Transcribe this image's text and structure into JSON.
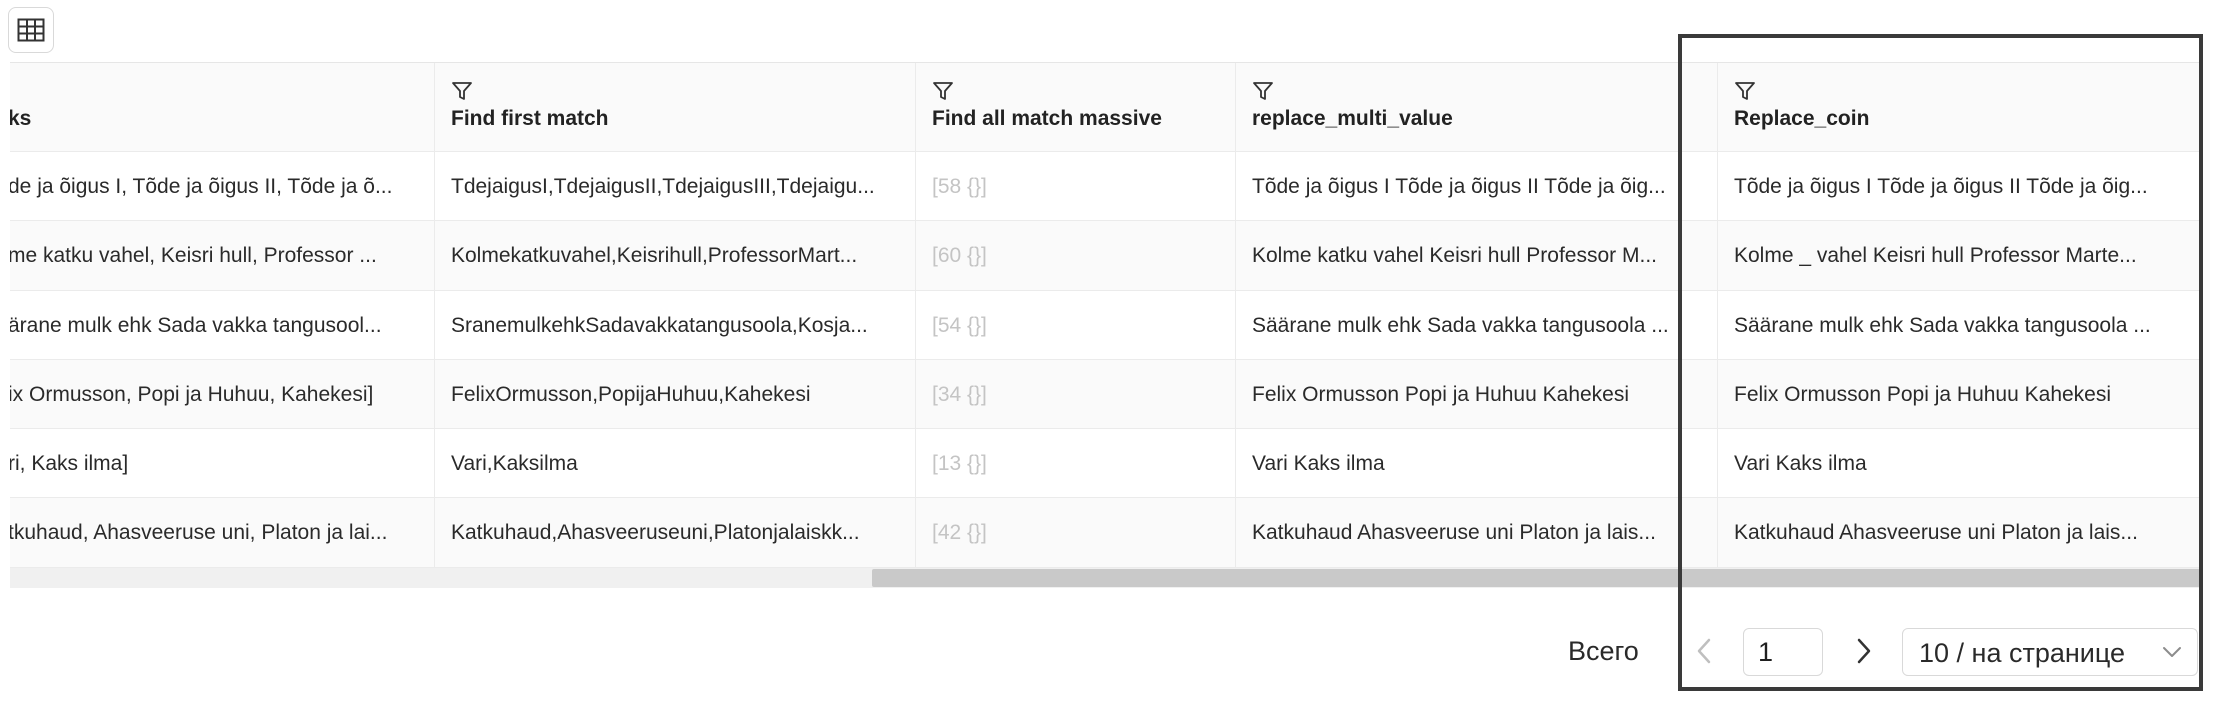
{
  "toolbar": {
    "table_icon": "table-grid-icon"
  },
  "columns": [
    {
      "key": "title",
      "label": "ks",
      "show_filter": false
    },
    {
      "key": "first",
      "label": "Find first match",
      "show_filter": true
    },
    {
      "key": "all",
      "label": "Find all match massive",
      "show_filter": true
    },
    {
      "key": "multi",
      "label": "replace_multi_value",
      "show_filter": true
    },
    {
      "key": "coin",
      "label": "Replace_coin",
      "show_filter": true
    }
  ],
  "rows": [
    {
      "title": "de ja õigus I, Tõde ja õigus II, Tõde ja õ...",
      "first": "TdejaigusI,TdejaigusII,TdejaigusIII,Tdejaigu...",
      "all": "[58 {}]",
      "multi": "Tõde ja õigus I Tõde ja õigus II Tõde ja õig...",
      "coin": "Tõde ja õigus I Tõde ja õigus II Tõde ja õig..."
    },
    {
      "title": "me katku vahel, Keisri hull, Professor ...",
      "first": "Kolmekatkuvahel,Keisrihull,ProfessorMart...",
      "all": "[60 {}]",
      "multi": "Kolme katku vahel Keisri hull Professor M...",
      "coin": "Kolme _ vahel Keisri hull Professor Marte..."
    },
    {
      "title": "ärane mulk ehk Sada vakka tangusool...",
      "first": "SranemulkehkSadavakkatangusoola,Kosja...",
      "all": "[54 {}]",
      "multi": "Säärane mulk ehk Sada vakka tangusoola ...",
      "coin": "Säärane mulk ehk Sada vakka tangusoola ..."
    },
    {
      "title": "ix Ormusson, Popi ja Huhuu, Kahekesi]",
      "first": "FelixOrmusson,PopijaHuhuu,Kahekesi",
      "all": "[34 {}]",
      "multi": "Felix Ormusson Popi ja Huhuu Kahekesi",
      "coin": "Felix Ormusson Popi ja Huhuu Kahekesi"
    },
    {
      "title": "ri, Kaks ilma]",
      "first": "Vari,Kaksilma",
      "all": "[13 {}]",
      "multi": "Vari Kaks ilma",
      "coin": "Vari Kaks ilma"
    },
    {
      "title": "tkuhaud, Ahasveeruse uni, Platon ja lai...",
      "first": "Katkuhaud,Ahasveeruseuni,Platonjalaiskk...",
      "all": "[42 {}]",
      "multi": "Katkuhaud Ahasveeruse uni Platon ja lais...",
      "coin": "Katkuhaud Ahasveeruse uni Platon ja lais..."
    }
  ],
  "pagination": {
    "total_label": "Всего",
    "current_page": "1",
    "page_size_label": "10 / на странице",
    "prev_icon": "chevron-left-icon",
    "next_icon": "chevron-right-icon",
    "select_icon": "chevron-down-icon"
  },
  "colors": {
    "border": "#ebebeb",
    "header_bg": "#fafafa",
    "muted_text": "#c4c4c4",
    "highlight_frame": "#3a3a3a"
  }
}
